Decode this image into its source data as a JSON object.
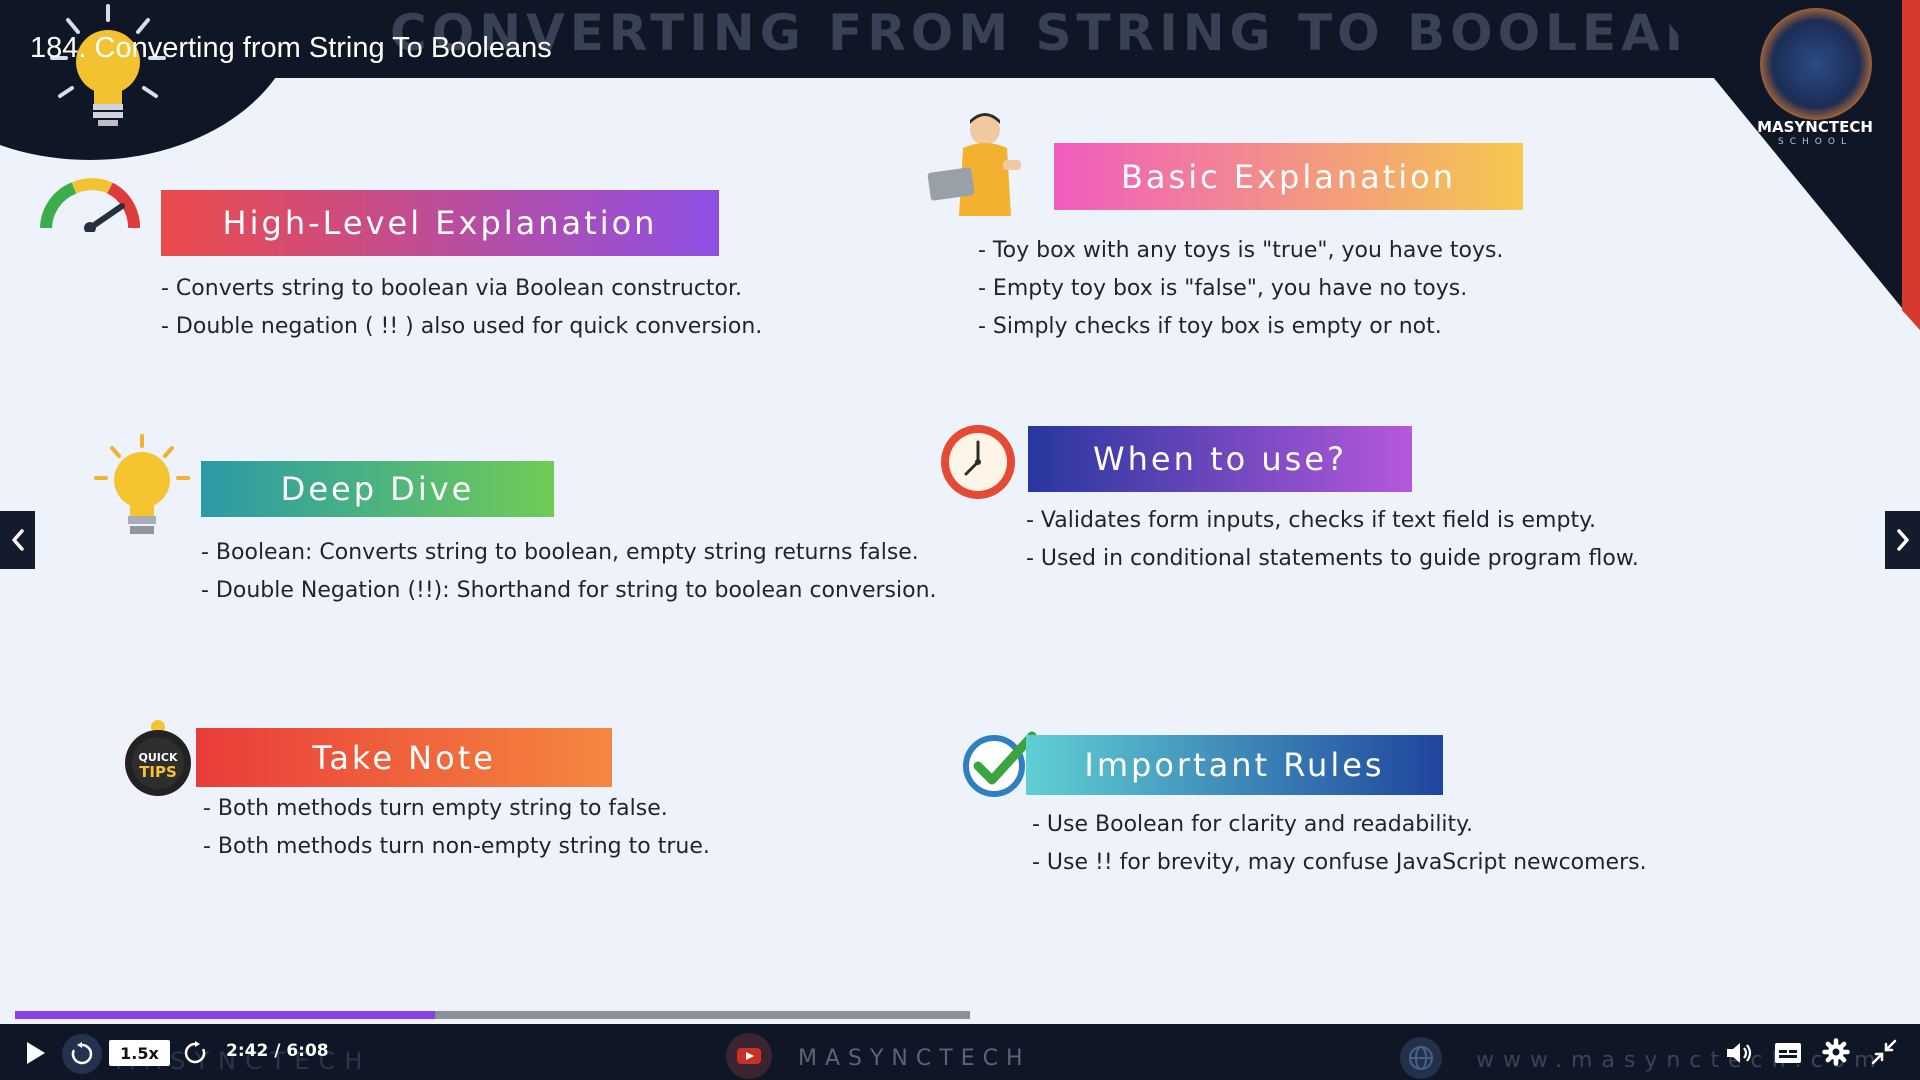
{
  "course": {
    "title": "184. Converting from String To Booleans"
  },
  "slide": {
    "heading": "CONVERTING FROM STRING TO BOOLEANS",
    "brand": {
      "name": "MASYNCTECH",
      "subtitle": "SCHOOL"
    },
    "sections": [
      {
        "title": "High-Level Explanation",
        "items": [
          "- Converts string to boolean via Boolean constructor.",
          "- Double negation ( !! ) also used for quick conversion."
        ]
      },
      {
        "title": "Basic Explanation",
        "items": [
          "- Toy box with any toys is \"true\", you have toys.",
          "- Empty toy box is \"false\", you have no toys.",
          "- Simply checks if toy box is empty or not."
        ]
      },
      {
        "title": "Deep Dive",
        "items": [
          "- Boolean: Converts string to boolean, empty string returns false.",
          "- Double Negation (!!): Shorthand for string to boolean conversion."
        ]
      },
      {
        "title": "When to use?",
        "items": [
          "- Validates form inputs, checks if text field is empty.",
          "- Used in conditional statements to guide program flow."
        ]
      },
      {
        "title": "Take Note",
        "items": [
          "- Both methods turn empty string to false.",
          "- Both methods turn non-empty string to true."
        ]
      },
      {
        "title": "Important Rules",
        "items": [
          "- Use Boolean for clarity and readability.",
          "- Use !! for brevity, may confuse JavaScript newcomers."
        ]
      }
    ],
    "tips_badge": [
      "QUICK",
      "TIPS"
    ]
  },
  "player": {
    "speed": "1.5x",
    "time": "2:42 / 6:08",
    "progress_fraction": 0.44,
    "watermarks": {
      "left": "MASYNCTECH",
      "middle": "MASYNCTECH",
      "right": "www.masynctech.com"
    }
  },
  "colors": {
    "progress": "#8b3fe8",
    "control_bar": "#0f1626"
  },
  "icons": [
    "lightbulb-icon",
    "gauge-icon",
    "person-laptop-icon",
    "clock-icon",
    "quick-tips-icon",
    "checkmark-icon",
    "chevron-left-icon",
    "chevron-right-icon",
    "play-icon",
    "rewind-icon",
    "forward-icon",
    "volume-icon",
    "captions-icon",
    "gear-icon",
    "minimize-icon",
    "youtube-icon",
    "globe-icon"
  ]
}
